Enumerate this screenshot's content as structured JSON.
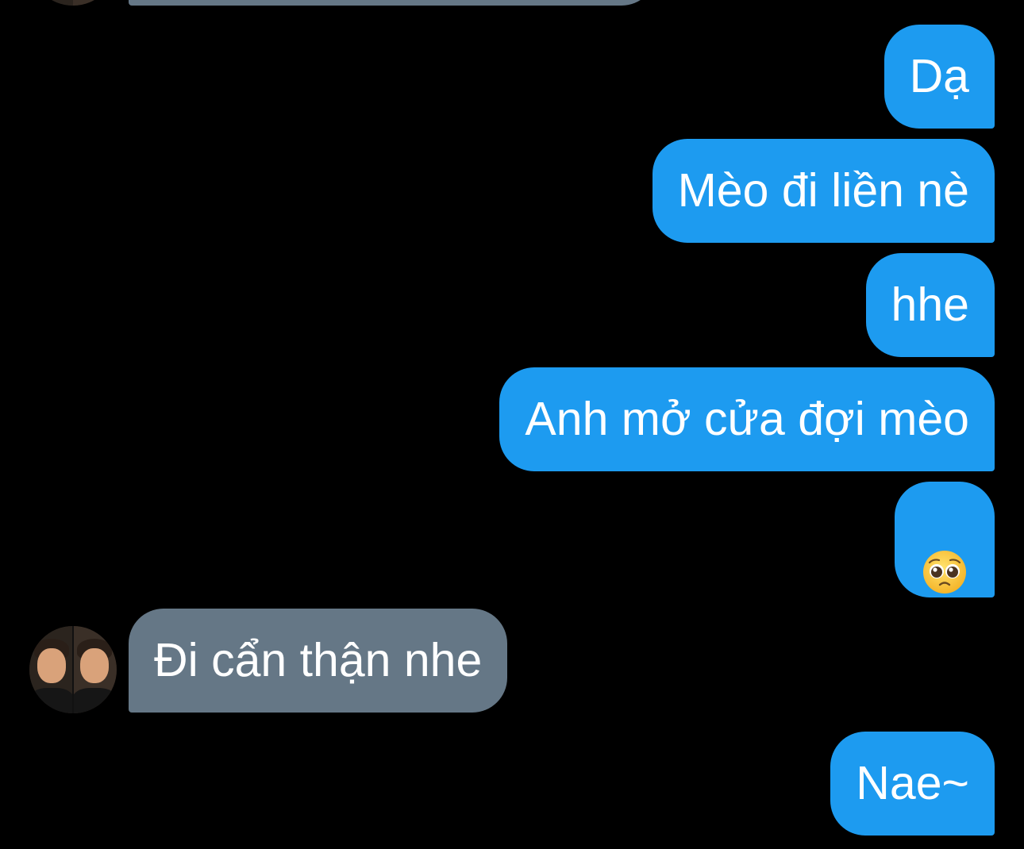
{
  "messages": [
    {
      "side": "received",
      "text": ""
    },
    {
      "side": "sent",
      "text": "Dạ"
    },
    {
      "side": "sent",
      "text": "Mèo đi liền nè"
    },
    {
      "side": "sent",
      "text": "hhe"
    },
    {
      "side": "sent",
      "text": "Anh mở cửa đợi mèo"
    },
    {
      "side": "sent",
      "emoji": "pleading-face",
      "text": ""
    },
    {
      "side": "received",
      "text": "Đi cẩn thận nhe"
    },
    {
      "side": "sent",
      "text": "Nae~"
    }
  ],
  "colors": {
    "background": "#000000",
    "sent_bubble": "#1d9bf0",
    "received_bubble": "#657786",
    "text": "#ffffff"
  }
}
